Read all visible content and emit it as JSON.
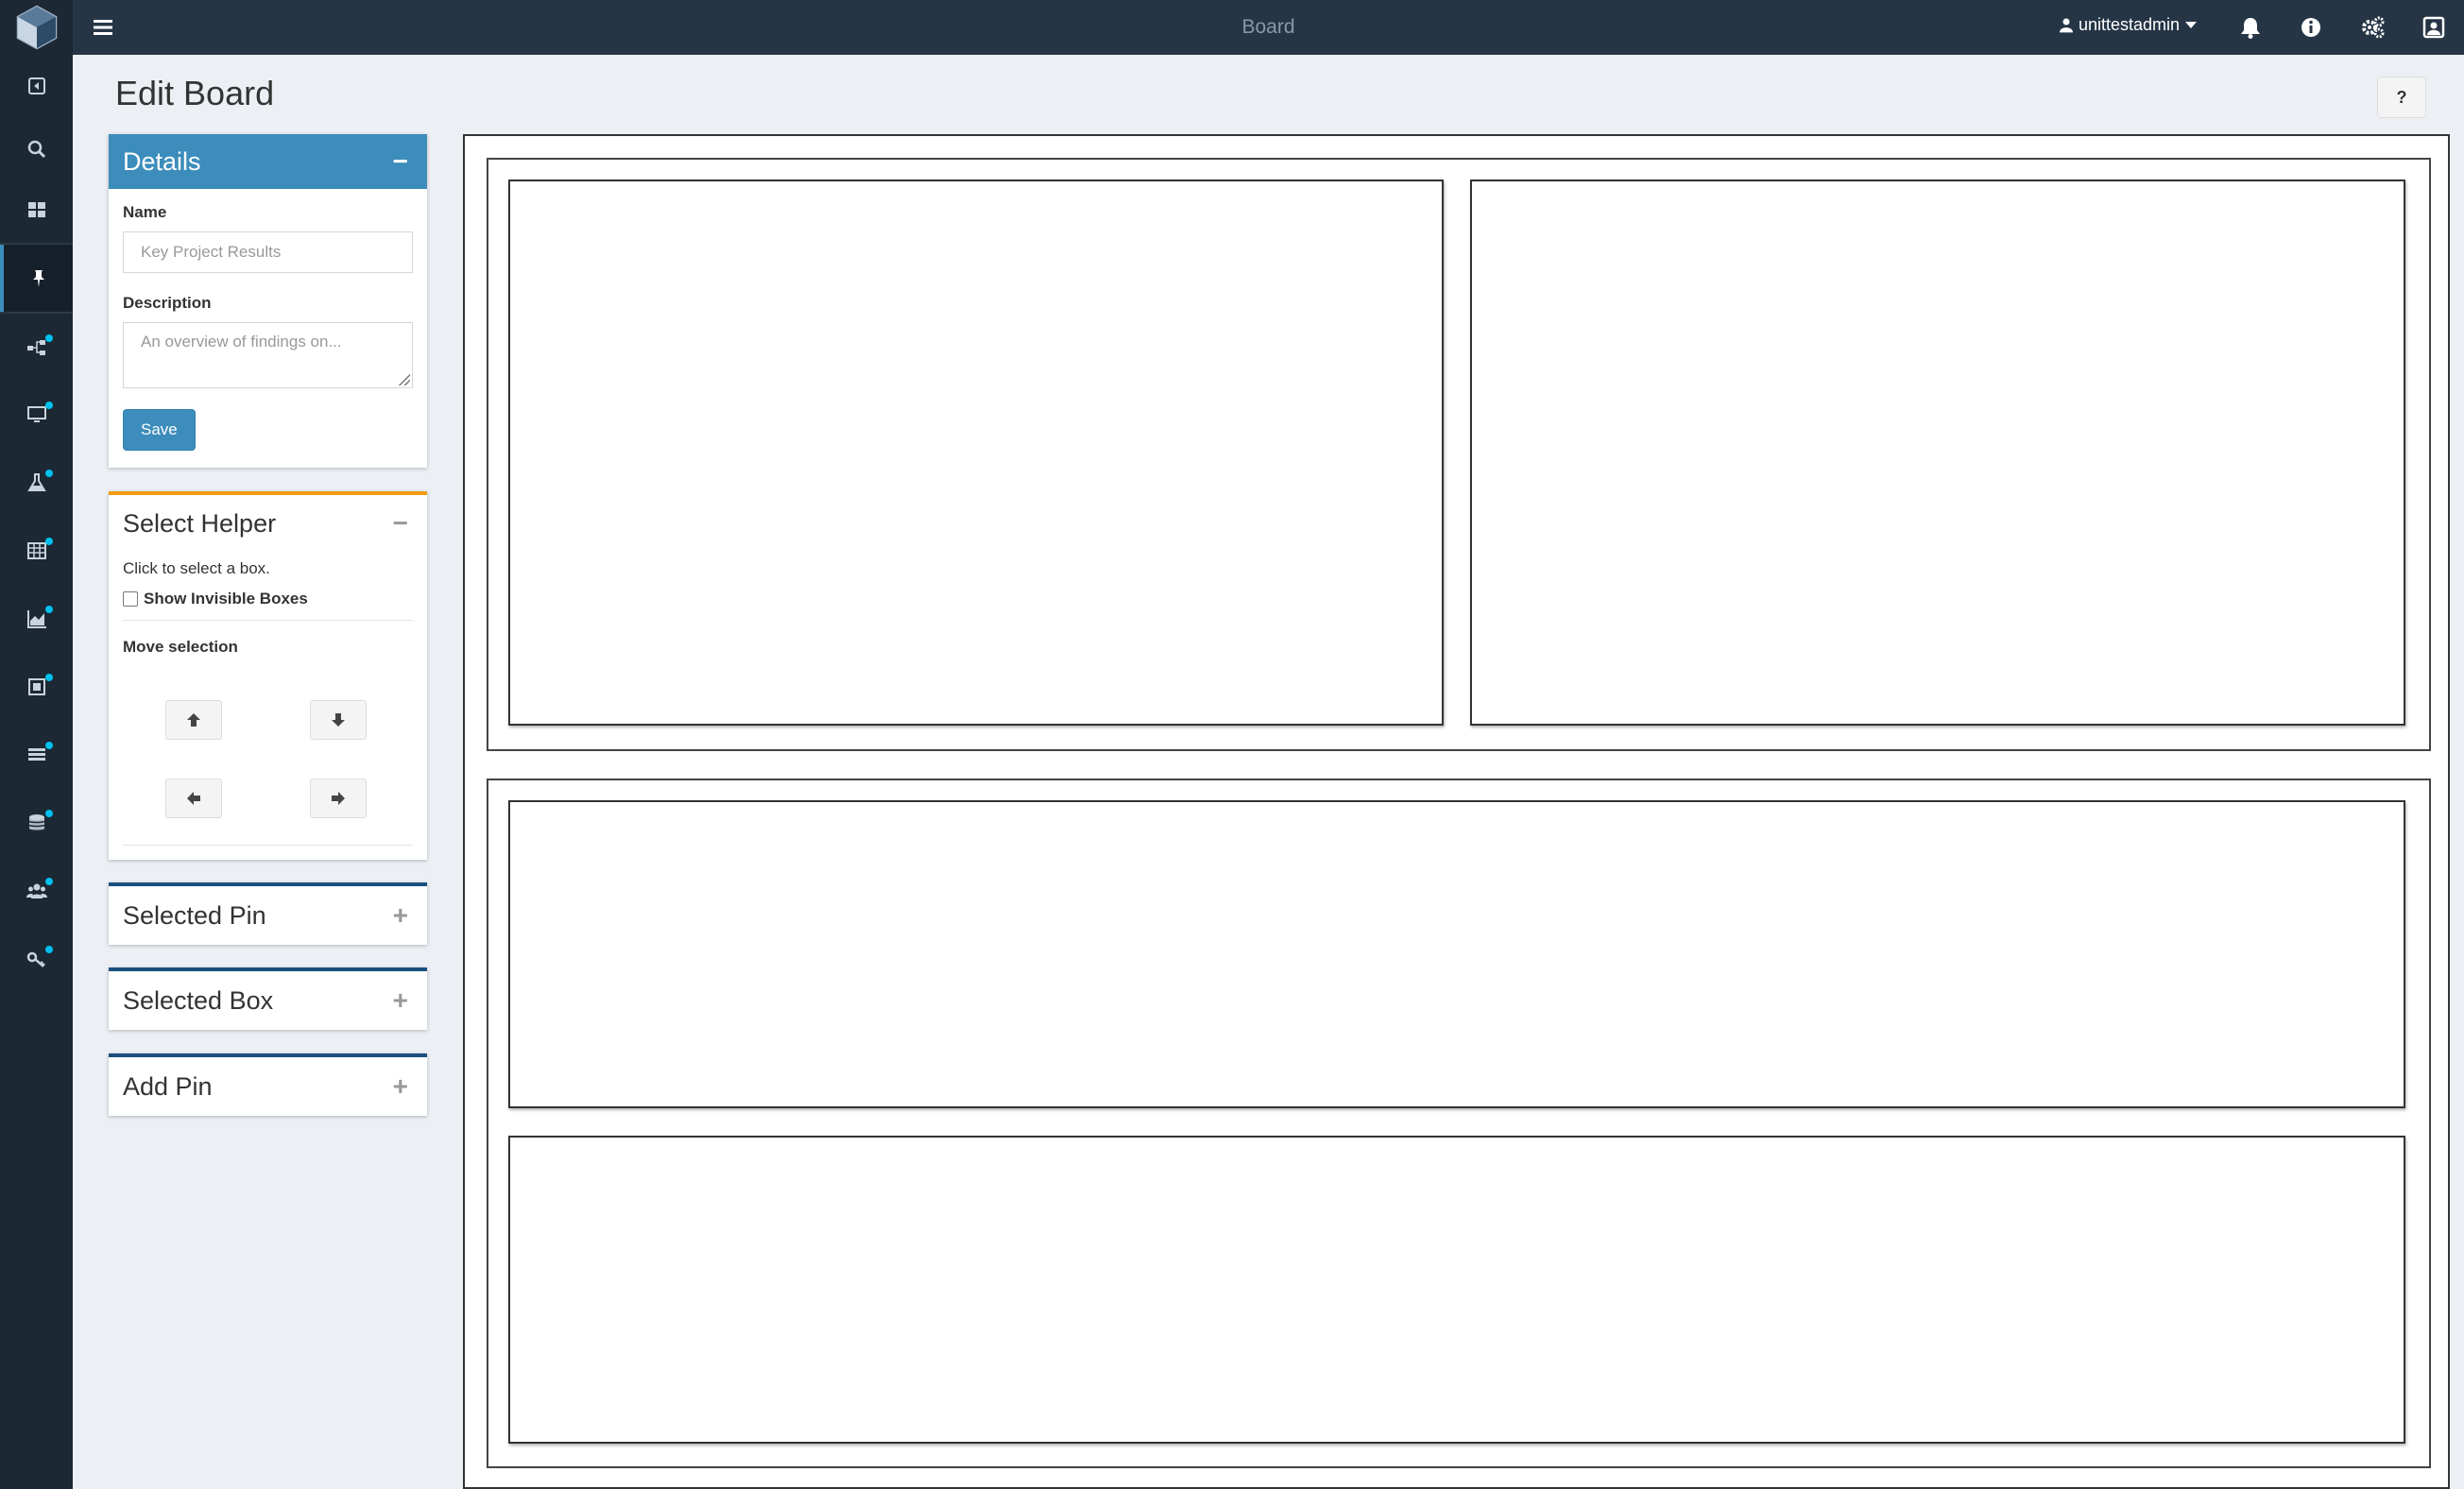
{
  "topbar": {
    "title": "Board",
    "username": "unittestadmin"
  },
  "page": {
    "title": "Edit Board",
    "help_label": "?"
  },
  "details": {
    "title": "Details",
    "toggle": "−",
    "name_label": "Name",
    "name_placeholder": "Key Project Results",
    "description_label": "Description",
    "description_placeholder": "An overview of findings on...",
    "save_label": "Save"
  },
  "select_helper": {
    "title": "Select Helper",
    "toggle": "−",
    "hint": "Click to select a box.",
    "show_invisible_label": "Show Invisible Boxes",
    "move_selection_label": "Move selection"
  },
  "collapsed_panels": [
    {
      "title": "Selected Pin",
      "toggle": "+"
    },
    {
      "title": "Selected Box",
      "toggle": "+"
    },
    {
      "title": "Add Pin",
      "toggle": "+"
    }
  ],
  "colors": {
    "sidebar": "#1c2833",
    "topbar": "#253546",
    "primary": "#3c8dbc",
    "helper_accent": "#f39c12",
    "collapsed_accent": "#1a4f80",
    "badge": "#00c0ef"
  },
  "sidebar_icons": [
    "back-icon",
    "search-icon",
    "dashboard-icon",
    "pin-icon",
    "workflow-icon",
    "monitor-icon",
    "flask-icon",
    "table-icon",
    "area-chart-icon",
    "frame-icon",
    "list-icon",
    "database-icon",
    "users-icon",
    "key-icon"
  ]
}
